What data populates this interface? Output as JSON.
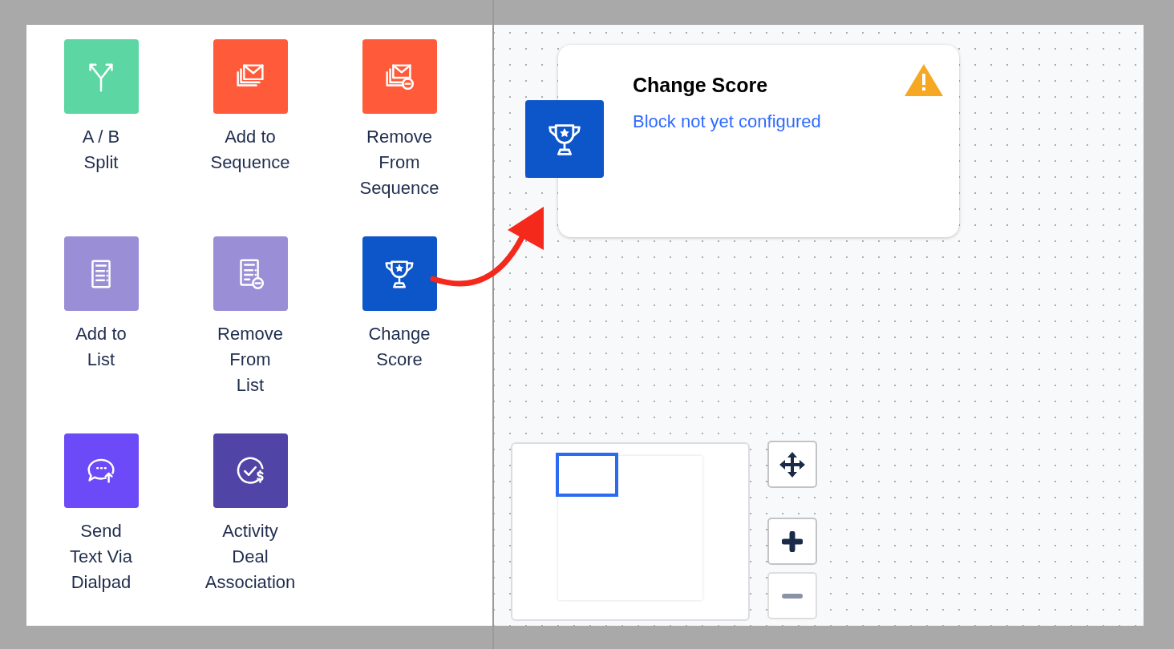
{
  "palette": {
    "items": [
      {
        "label": "A / B\nSplit",
        "kind": "split",
        "color": "#5cd6a2"
      },
      {
        "label": "Add to\nSequence",
        "kind": "sequence-add",
        "color": "#ff5a39"
      },
      {
        "label": "Remove\nFrom\nSequence",
        "kind": "sequence-remove",
        "color": "#ff5a39"
      },
      {
        "label": "Add to\nList",
        "kind": "list-add",
        "color": "#9a8fd6"
      },
      {
        "label": "Remove\nFrom\nList",
        "kind": "list-remove",
        "color": "#9a8fd6"
      },
      {
        "label": "Change\nScore",
        "kind": "score",
        "color": "#0c56c9"
      },
      {
        "label": "Send\nText Via\nDialpad",
        "kind": "sms",
        "color": "#6c4af8"
      },
      {
        "label": "Activity\nDeal\nAssociation",
        "kind": "deal",
        "color": "#5045a6"
      }
    ]
  },
  "canvas": {
    "node": {
      "kind": "score",
      "title": "Change Score",
      "status": "Block not yet configured",
      "warning": true
    },
    "controls": [
      {
        "kind": "move",
        "disabled": false
      },
      {
        "kind": "zoom-in",
        "disabled": false
      },
      {
        "kind": "zoom-out",
        "disabled": true
      }
    ]
  }
}
